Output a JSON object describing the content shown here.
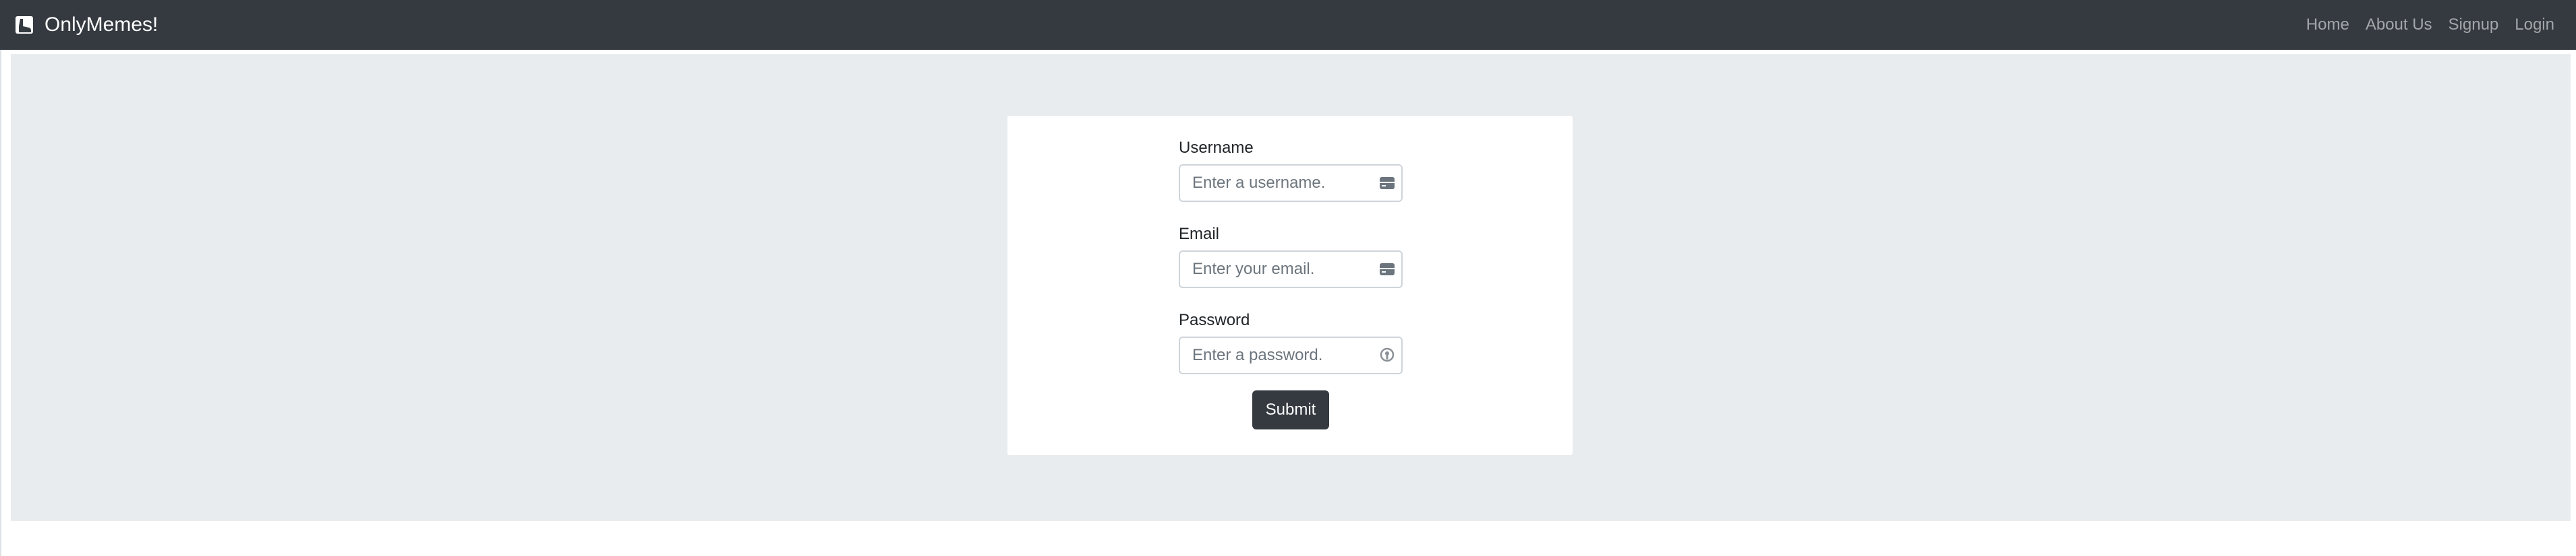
{
  "navbar": {
    "brand": "OnlyMemes!",
    "brand_icon": "boot-icon",
    "links": [
      {
        "label": "Home"
      },
      {
        "label": "About Us"
      },
      {
        "label": "Signup"
      },
      {
        "label": "Login"
      }
    ]
  },
  "form": {
    "username": {
      "label": "Username",
      "placeholder": "Enter a username.",
      "icon": "autofill-card-icon"
    },
    "email": {
      "label": "Email",
      "placeholder": "Enter your email.",
      "icon": "autofill-card-icon"
    },
    "password": {
      "label": "Password",
      "placeholder": "Enter a password.",
      "icon": "password-key-icon"
    },
    "submit_label": "Submit"
  },
  "colors": {
    "navbar_bg": "#343a40",
    "jumbotron_bg": "#e9ecef",
    "button_bg": "#343a40"
  }
}
